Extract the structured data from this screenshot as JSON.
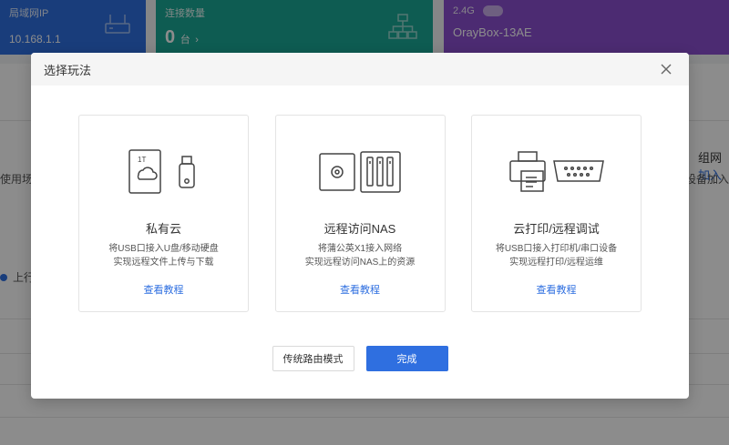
{
  "background": {
    "cards": [
      {
        "label": "局域网IP",
        "value": "10.168.1.1"
      },
      {
        "label": "连接数量",
        "value": "0",
        "unit": "台"
      },
      {
        "label": "2.4G",
        "value": "OrayBox-13AE"
      }
    ],
    "right_title": "组网",
    "right_link": "加入",
    "right_desc": "设备加入",
    "left_desc": "使用场",
    "upload_label": "上行"
  },
  "modal": {
    "title": "选择玩法",
    "options": [
      {
        "title": "私有云",
        "desc_line1": "将USB口接入U盘/移动硬盘",
        "desc_line2": "实现远程文件上传与下载",
        "link": "查看教程",
        "illus_label": "1T"
      },
      {
        "title": "远程访问NAS",
        "desc_line1": "将蒲公英X1接入网络",
        "desc_line2": "实现远程访问NAS上的资源",
        "link": "查看教程"
      },
      {
        "title": "云打印/远程调试",
        "desc_line1": "将USB口接入打印机/串口设备",
        "desc_line2": "实现远程打印/远程运维",
        "link": "查看教程"
      }
    ],
    "buttons": {
      "secondary": "传统路由模式",
      "primary": "完成"
    }
  },
  "colors": {
    "accent": "#2f6fe0",
    "card_blue": "#2f6fe0",
    "card_teal": "#1aa895",
    "card_purple": "#8a4fd0"
  }
}
